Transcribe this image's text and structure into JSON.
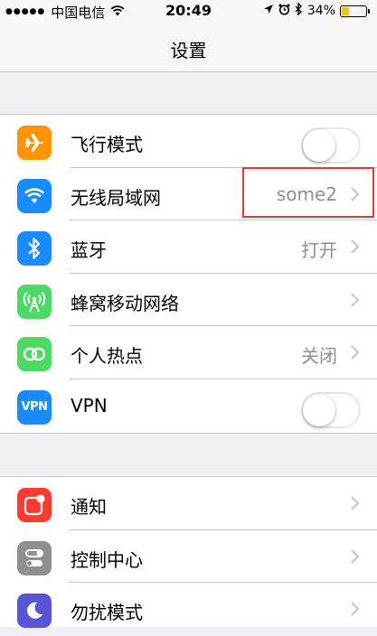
{
  "status_bar": {
    "carrier": "中国电信",
    "time": "20:49",
    "battery": "34%",
    "battery_level": 0.34
  },
  "nav": {
    "title": "设置"
  },
  "group1": [
    {
      "label": "飞行模式",
      "icon": "airplane-icon",
      "color": "#ff9500",
      "toggle": false
    },
    {
      "label": "无线局域网",
      "icon": "wifi-icon",
      "color": "#1a8cff",
      "value": "some2"
    },
    {
      "label": "蓝牙",
      "icon": "bluetooth-icon",
      "color": "#1a8cff",
      "value": "打开"
    },
    {
      "label": "蜂窝移动网络",
      "icon": "cellular-icon",
      "color": "#4cd964"
    },
    {
      "label": "个人热点",
      "icon": "hotspot-icon",
      "color": "#4cd964",
      "value": "关闭"
    },
    {
      "label": "VPN",
      "icon": "vpn-icon",
      "icon_text": "VPN",
      "color": "#1a8cff",
      "toggle": false
    }
  ],
  "group2": [
    {
      "label": "通知",
      "icon": "notifications-icon",
      "color": "#ff3b30"
    },
    {
      "label": "控制中心",
      "icon": "control-center-icon",
      "color": "#8e8e93"
    },
    {
      "label": "勿扰模式",
      "icon": "moon-icon",
      "color": "#5856d6"
    }
  ]
}
